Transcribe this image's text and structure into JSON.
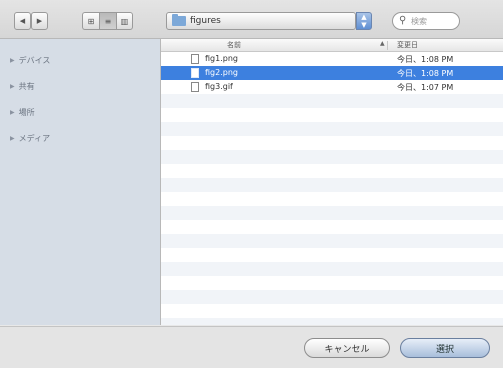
{
  "toolbar": {
    "back_icon": "◀",
    "forward_icon": "▶",
    "view_icons": [
      "⊞",
      "≡",
      "▥"
    ],
    "active_view": 1,
    "folder": "figures",
    "search_placeholder": "検索"
  },
  "sidebar": {
    "items": [
      {
        "label": "デバイス"
      },
      {
        "label": "共有"
      },
      {
        "label": "場所"
      },
      {
        "label": "メディア"
      }
    ]
  },
  "list": {
    "headers": {
      "name": "名前",
      "date": "変更日"
    },
    "files": [
      {
        "name": "fig1.png",
        "date": "今日、1:08 PM",
        "selected": false
      },
      {
        "name": "fig2.png",
        "date": "今日、1:08 PM",
        "selected": true
      },
      {
        "name": "fig3.gif",
        "date": "今日、1:07 PM",
        "selected": false
      }
    ]
  },
  "buttons": {
    "cancel": "キャンセル",
    "choose": "選択"
  },
  "colors": {
    "selection": "#3d80df",
    "sidebar": "#d6dde6"
  }
}
